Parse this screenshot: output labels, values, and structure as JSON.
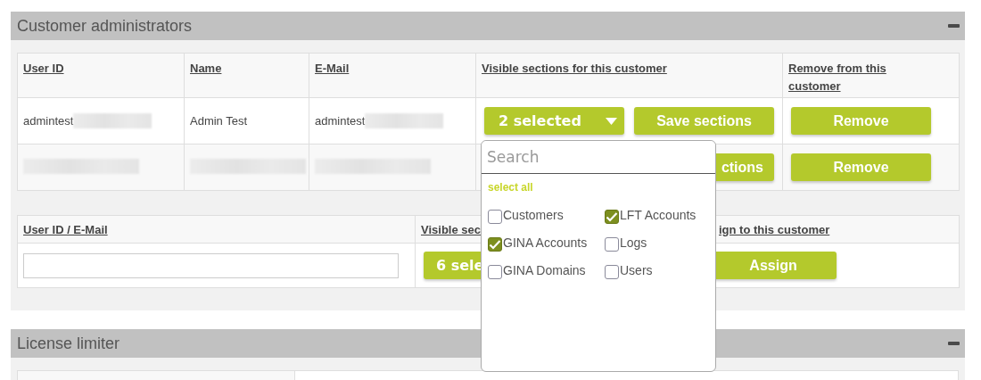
{
  "admins_panel": {
    "title": "Customer administrators",
    "columns": [
      "User ID",
      "Name",
      "E-Mail",
      "Visible sections for this customer",
      "Remove from this customer"
    ],
    "rows": [
      {
        "user_id": "admintest",
        "user_id_redacted": true,
        "name": "Admin Test",
        "email": "admintest",
        "email_redacted": true,
        "sections_button": "2 selected",
        "save_button": "Save sections",
        "remove_button": "Remove"
      },
      {
        "user_id_redacted": true,
        "name_redacted": true,
        "email_redacted": true,
        "save_button": "ctions",
        "remove_button": "Remove"
      }
    ]
  },
  "assign_table": {
    "columns": [
      "User ID / E-Mail",
      "Visible sec",
      "ign to this customer"
    ],
    "sections_button": "6 sele",
    "assign_button": "Assign"
  },
  "license_panel": {
    "title": "License limiter"
  },
  "sections_popup": {
    "search": {
      "placeholder": "Search"
    },
    "select_all": "select all",
    "options": [
      {
        "label": "Customers",
        "checked": false
      },
      {
        "label": "LFT Accounts",
        "checked": true
      },
      {
        "label": "GINA Accounts",
        "checked": true
      },
      {
        "label": "Logs",
        "checked": false
      },
      {
        "label": "GINA Domains",
        "checked": false
      },
      {
        "label": "Users",
        "checked": false
      }
    ]
  }
}
